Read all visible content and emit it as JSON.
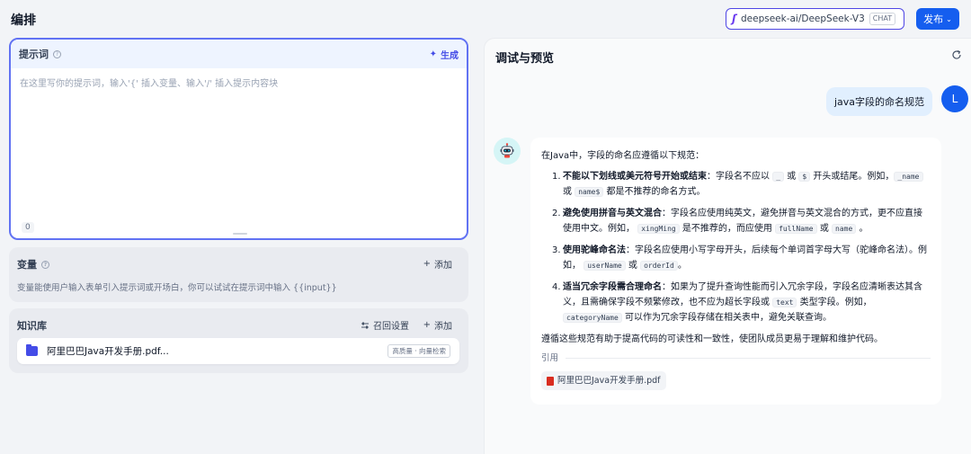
{
  "header": {
    "title": "编排",
    "model": {
      "name": "deepseek-ai/DeepSeek-V3",
      "badge": "CHAT"
    },
    "publish_label": "发布"
  },
  "prompt": {
    "label": "提示词",
    "generate_label": "生成",
    "placeholder": "在这里写你的提示词，输入'{' 插入变量、输入'/' 插入提示内容块",
    "char_count": "0"
  },
  "variables": {
    "label": "变量",
    "add_label": "添加",
    "description": "变量能使用户输入表单引入提示词或开场白，你可以试试在提示词中输入 {{input}}"
  },
  "knowledge": {
    "label": "知识库",
    "recall_label": "召回设置",
    "add_label": "添加",
    "items": [
      {
        "name": "阿里巴巴Java开发手册.pdf...",
        "tag": "高质量 · 向量检索"
      }
    ]
  },
  "debug": {
    "title": "调试与预览",
    "user_avatar": "L",
    "user_message": "java字段的命名规范",
    "bot": {
      "intro": "在Java中，字段的命名应遵循以下规范：",
      "rules": [
        {
          "num": "1.",
          "title": "不能以下划线或美元符号开始或结束",
          "p1": "：字段名不应以",
          "c1": "_",
          "p2": "或",
          "c2": "$",
          "p3": "开头或结尾。例如，",
          "c3": "_name",
          "p4": "或",
          "c4": "name$",
          "p5": "都是不推荐的命名方式。"
        },
        {
          "num": "2.",
          "title": "避免使用拼音与英文混合",
          "p1": "：字段名应使用纯英文，避免拼音与英文混合的方式，更不应直接使用中文。例如，",
          "c1": "xingMing",
          "p2": "是不推荐的，而应使用",
          "c2": "fullName",
          "p3": "或",
          "c3": "name",
          "p4": "。"
        },
        {
          "num": "3.",
          "title": "使用驼峰命名法",
          "p1": "：字段名应使用小写字母开头，后续每个单词首字母大写（驼峰命名法）。例如，",
          "c1": "userName",
          "p2": "或",
          "c2": "orderId",
          "p3": "。"
        },
        {
          "num": "4.",
          "title": "适当冗余字段需合理命名",
          "p1": "：如果为了提升查询性能而引入冗余字段，字段名应清晰表达其含义，且需确保字段不频繁修改，也不应为超长字段或",
          "c1": "text",
          "p2": "类型字段。例如，",
          "c2": "categoryName",
          "p3": "可以作为冗余字段存储在相关表中，避免关联查询。"
        }
      ],
      "summary": "遵循这些规范有助于提高代码的可读性和一致性，使团队成员更易于理解和维护代码。",
      "citation_label": "引用",
      "citation_file": "阿里巴巴Java开发手册.pdf"
    }
  },
  "colors": {
    "accent": "#155eef",
    "prompt_border": "#6172f3",
    "generate": "#444ce7"
  }
}
